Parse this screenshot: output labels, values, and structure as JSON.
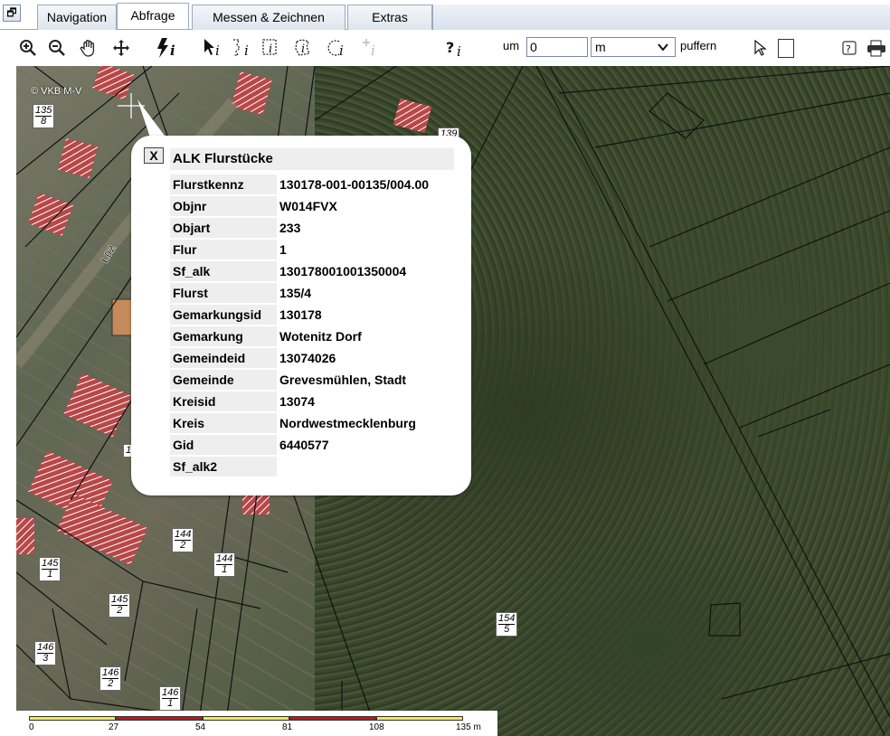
{
  "tabs": {
    "window_icon": "window-restore-icon",
    "items": [
      {
        "label": "Navigation",
        "active": false
      },
      {
        "label": "Abfrage",
        "active": true
      },
      {
        "label": "Messen & Zeichnen",
        "active": false
      },
      {
        "label": "Extras",
        "active": false
      }
    ]
  },
  "toolbar": {
    "tools": [
      "zoom-in-icon",
      "zoom-out-icon",
      "pan-hand-icon",
      "move-cross-icon",
      "info-lightning-icon",
      "info-pointer-icon",
      "info-select-icon",
      "info-rectangle-icon",
      "info-polygon-icon",
      "info-circle-icon",
      "info-add-icon",
      "help-info-icon"
    ],
    "buffer_label_pre": "um",
    "buffer_value": "0",
    "buffer_unit": "m",
    "buffer_label_post": "puffern",
    "right_icons": [
      "cursor-icon",
      "help-icon",
      "print-icon"
    ]
  },
  "map": {
    "copyright": "© VKB M-V",
    "road_label": "L02",
    "parcel_labels": [
      {
        "num": "135",
        "den": "8"
      },
      {
        "num": "144",
        "den": "2"
      },
      {
        "num": "144",
        "den": "1"
      },
      {
        "num": "145",
        "den": "1"
      },
      {
        "num": "145",
        "den": "2"
      },
      {
        "num": "146",
        "den": "3"
      },
      {
        "num": "146",
        "den": "2"
      },
      {
        "num": "146",
        "den": "1"
      },
      {
        "num": "154",
        "den": "5"
      }
    ],
    "partial_labels": [
      "139",
      "1"
    ]
  },
  "popup": {
    "title": "ALK Flurstücke",
    "close_label": "X",
    "rows": [
      {
        "key": "Flurstkennz",
        "value": "130178-001-00135/004.00"
      },
      {
        "key": "Objnr",
        "value": "W014FVX"
      },
      {
        "key": "Objart",
        "value": "233"
      },
      {
        "key": "Flur",
        "value": "1"
      },
      {
        "key": "Sf_alk",
        "value": "130178001001350004"
      },
      {
        "key": "Flurst",
        "value": "135/4"
      },
      {
        "key": "Gemarkungsid",
        "value": "130178"
      },
      {
        "key": "Gemarkung",
        "value": "Wotenitz Dorf"
      },
      {
        "key": "Gemeindeid",
        "value": "13074026"
      },
      {
        "key": "Gemeinde",
        "value": "Grevesmühlen, Stadt"
      },
      {
        "key": "Kreisid",
        "value": "13074"
      },
      {
        "key": "Kreis",
        "value": "Nordwestmecklenburg"
      },
      {
        "key": "Gid",
        "value": "6440577"
      },
      {
        "key": "Sf_alk2",
        "value": ""
      }
    ]
  },
  "scalebar": {
    "ticks": [
      "0",
      "27",
      "54",
      "81",
      "108",
      "135 m"
    ],
    "colors": [
      "#f2e85a",
      "#c01818",
      "#f2e85a",
      "#c01818",
      "#f2e85a"
    ]
  }
}
